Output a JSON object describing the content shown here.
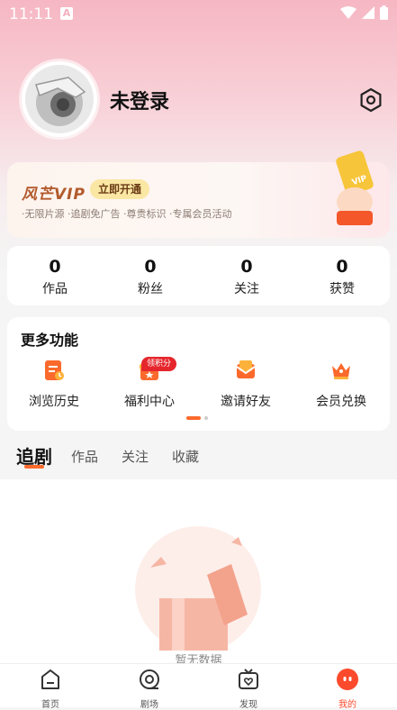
{
  "status": {
    "time": "11:11"
  },
  "profile": {
    "username": "未登录"
  },
  "vip": {
    "logo": "风芒VIP",
    "open_label": "立即开通",
    "description": "·无限片源 ·追剧免广告 ·尊贵标识 ·专属会员活动"
  },
  "stats": [
    {
      "value": "0",
      "label": "作品"
    },
    {
      "value": "0",
      "label": "粉丝"
    },
    {
      "value": "0",
      "label": "关注"
    },
    {
      "value": "0",
      "label": "获赞"
    }
  ],
  "more": {
    "title": "更多功能",
    "badge": "领积分",
    "items": [
      {
        "label": "浏览历史",
        "icon": "history-icon"
      },
      {
        "label": "福利中心",
        "icon": "gift-icon"
      },
      {
        "label": "邀请好友",
        "icon": "invite-icon"
      },
      {
        "label": "会员兑换",
        "icon": "crown-icon"
      }
    ]
  },
  "tabs": [
    {
      "label": "追剧"
    },
    {
      "label": "作品"
    },
    {
      "label": "关注"
    },
    {
      "label": "收藏"
    }
  ],
  "empty": {
    "text": "暂无数据"
  },
  "bottom_nav": [
    {
      "label": "首页",
      "icon": "home-icon"
    },
    {
      "label": "剧场",
      "icon": "theater-icon"
    },
    {
      "label": "发现",
      "icon": "discover-icon"
    },
    {
      "label": "我的",
      "icon": "profile-icon"
    }
  ],
  "colors": {
    "accent": "#fb6a2c",
    "badge": "#e5262c",
    "vip_button": "#fbe7a4"
  }
}
